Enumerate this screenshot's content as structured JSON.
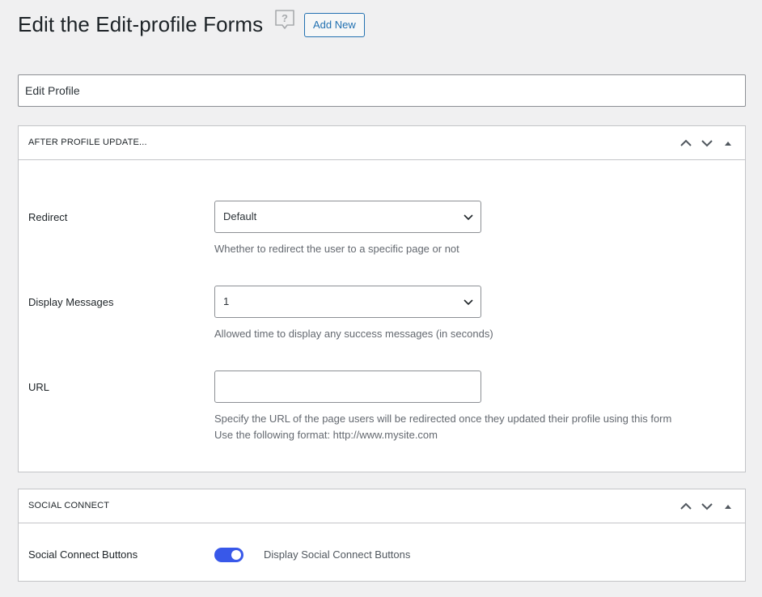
{
  "header": {
    "title": "Edit the Edit-profile Forms",
    "help_icon": "question-bubble-icon",
    "add_new_label": "Add New"
  },
  "form_title": {
    "value": "Edit Profile"
  },
  "after_update_box": {
    "title": "AFTER PROFILE UPDATE...",
    "redirect": {
      "label": "Redirect",
      "selected": "Default",
      "description": "Whether to redirect the user to a specific page or not"
    },
    "display_messages": {
      "label": "Display Messages",
      "selected": "1",
      "description": "Allowed time to display any success messages (in seconds)"
    },
    "url": {
      "label": "URL",
      "value": "",
      "description_line1": "Specify the URL of the page users will be redirected once they updated their profile using this form",
      "description_line2": "Use the following format: http://www.mysite.com"
    }
  },
  "social_connect_box": {
    "title": "SOCIAL CONNECT",
    "buttons_row": {
      "label": "Social Connect Buttons",
      "toggle_on": true,
      "toggle_label": "Display Social Connect Buttons"
    }
  },
  "colors": {
    "accent": "#2271b1",
    "toggle_on": "#3858e9",
    "background": "#f0f0f1"
  }
}
